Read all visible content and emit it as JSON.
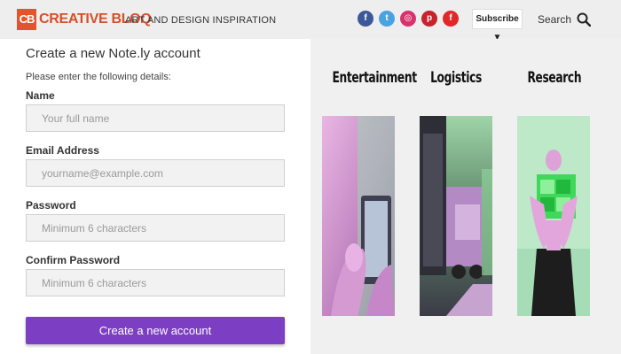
{
  "header": {
    "logo_mark": "CB",
    "logo_text": "CREATIVE BLOQ",
    "tagline": "ART AND DESIGN INSPIRATION",
    "socials": [
      {
        "name": "facebook",
        "glyph": "f",
        "color": "#3b5998"
      },
      {
        "name": "twitter",
        "glyph": "t",
        "color": "#4aa3df"
      },
      {
        "name": "instagram",
        "glyph": "◎",
        "color": "#d6336c"
      },
      {
        "name": "pinterest",
        "glyph": "p",
        "color": "#c8232c"
      },
      {
        "name": "flipboard",
        "glyph": "f",
        "color": "#e12828"
      }
    ],
    "subscribe_label": "Subscribe ▼",
    "search_label": "Search"
  },
  "form": {
    "title": "Create a new Note.ly account",
    "intro": "Please enter the following details:",
    "fields": [
      {
        "label": "Name",
        "placeholder": "Your full name"
      },
      {
        "label": "Email Address",
        "placeholder": "yourname@example.com"
      },
      {
        "label": "Password",
        "placeholder": "Minimum 6 characters"
      },
      {
        "label": "Confirm Password",
        "placeholder": "Minimum 6 characters"
      }
    ],
    "submit_label": "Create a new account"
  },
  "categories": [
    {
      "title": "Entertainment",
      "image_icon": "tablet-hands-image"
    },
    {
      "title": "Logistics",
      "image_icon": "truck-image"
    },
    {
      "title": "Research",
      "image_icon": "cube-person-image"
    }
  ],
  "colors": {
    "brand": "#e2542b",
    "button": "#7c3ec2",
    "image_tint_green": "#8fdca8",
    "image_tint_pink": "#e08fd0"
  }
}
